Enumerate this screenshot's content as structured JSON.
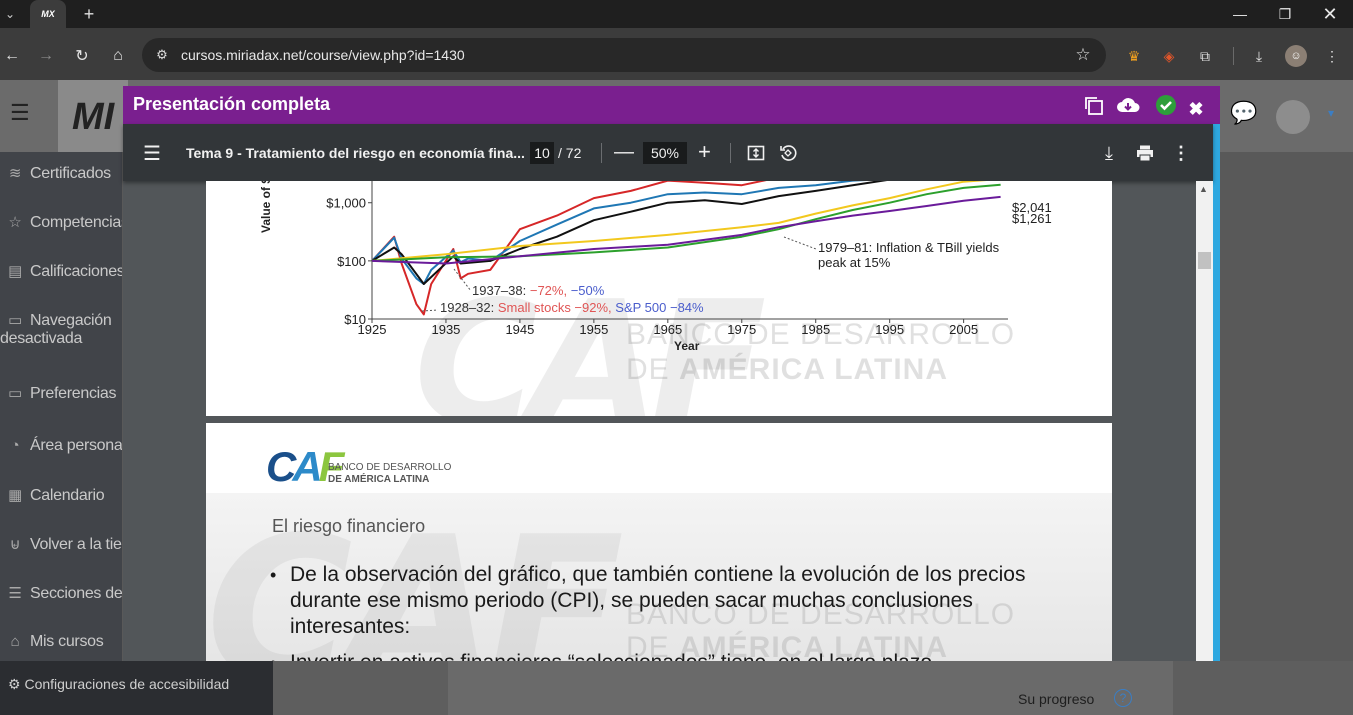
{
  "browser": {
    "tab_favicon": "MX",
    "url": "cursos.miriadax.net/course/view.php?id=1430"
  },
  "page": {
    "logo": "MI",
    "sidebar": [
      {
        "icon": "layers-icon",
        "glyph": "≋",
        "label": "Certificados"
      },
      {
        "icon": "star-icon",
        "glyph": "☆",
        "label": "Competencias"
      },
      {
        "icon": "book-icon",
        "glyph": "▤",
        "label": "Calificaciones"
      },
      {
        "icon": "folder-icon",
        "glyph": "▭",
        "label": "Navegación",
        "label2": "desactivada"
      },
      {
        "icon": "folder-icon",
        "glyph": "▭",
        "label": "Preferencias"
      },
      {
        "icon": "dashboard-icon",
        "glyph": "◔",
        "label": "Área personal"
      },
      {
        "icon": "calendar-icon",
        "glyph": "▦",
        "label": "Calendario"
      },
      {
        "icon": "cart-icon",
        "glyph": "⊌",
        "label": "Volver a la tienda"
      },
      {
        "icon": "list-icon",
        "glyph": "☰",
        "label": "Secciones del curso"
      },
      {
        "icon": "graduation-icon",
        "glyph": "⌂",
        "label": "Mis cursos"
      }
    ],
    "accessibility_label": "Configuraciones de accesibilidad",
    "progress_label": "Su progreso",
    "help_glyph": "?"
  },
  "modal": {
    "title": "Presentación completa"
  },
  "pdf": {
    "title": "Tema 9 - Tratamiento del riesgo en economía fina...",
    "page_current": "10",
    "page_total": "/ 72",
    "zoom": "50%"
  },
  "slide1": {
    "chart": {
      "ylabel": "Value of $",
      "xlabel": "Year",
      "y_ticks": [
        "$10",
        "$100",
        "$1,000"
      ],
      "x_ticks": [
        "1925",
        "1935",
        "1945",
        "1955",
        "1965",
        "1975",
        "1985",
        "1995",
        "2005"
      ],
      "end_labels": [
        "$2,041",
        "$1,261"
      ],
      "annotation_1979": "1979–81: Inflation & TBill yields",
      "annotation_1979_b": "peak at 15%",
      "annotation_1937_prefix": "1937–38:",
      "annotation_1937_red": "−72%,",
      "annotation_1937_blue": "−50%",
      "annotation_1928_prefix": "1928–32:",
      "annotation_1928_red": "Small stocks −92%,",
      "annotation_1928_blue": "S&P 500 −84%"
    },
    "watermark_line1": "BANCO DE DESARROLLO",
    "watermark_line2_a": "DE ",
    "watermark_line2_b": "AMÉRICA LATINA"
  },
  "slide2": {
    "logo_caf": "CAF",
    "logo_line1": "BANCO DE DESARROLLO",
    "logo_line2": "DE AMÉRICA LATINA",
    "heading": "El riesgo financiero",
    "bullets": [
      "De la observación del gráfico, que también contiene la evolución de los precios durante ese mismo periodo (CPI), se pueden sacar muchas conclusiones interesantes:",
      "Invertir en activos financieros “seleccionados” tiene, en el largo plazo"
    ]
  },
  "chart_data": {
    "type": "line",
    "title": "",
    "xlabel": "Year",
    "ylabel": "Value of $",
    "xlim": [
      1925,
      2011
    ],
    "ylim": [
      10,
      3000
    ],
    "y_scale": "log",
    "series": [
      {
        "color": "#d62728",
        "x": [
          1925,
          1928,
          1929,
          1931,
          1932,
          1933,
          1936,
          1937,
          1938,
          1941,
          1945,
          1950,
          1955,
          1960,
          1965,
          1970,
          1975,
          1979
        ],
        "y": [
          100,
          260,
          90,
          18,
          12,
          40,
          160,
          50,
          60,
          70,
          350,
          600,
          1200,
          1600,
          2400,
          2200,
          2000,
          3000
        ]
      },
      {
        "color": "#1f77b4",
        "x": [
          1925,
          1928,
          1929,
          1931,
          1932,
          1933,
          1936,
          1937,
          1938,
          1941,
          1945,
          1950,
          1955,
          1960,
          1965,
          1970,
          1975,
          1980,
          1985,
          1990,
          1995
        ],
        "y": [
          100,
          250,
          110,
          50,
          40,
          70,
          150,
          95,
          110,
          100,
          220,
          420,
          800,
          1000,
          1400,
          1500,
          1400,
          1800,
          2000,
          2400,
          3000
        ]
      },
      {
        "color": "#111111",
        "x": [
          1925,
          1928,
          1929,
          1932,
          1936,
          1937,
          1941,
          1945,
          1950,
          1955,
          1960,
          1965,
          1970,
          1975,
          1980,
          1985,
          1990,
          1995,
          2000
        ],
        "y": [
          100,
          170,
          130,
          40,
          120,
          90,
          100,
          160,
          260,
          500,
          700,
          1000,
          1100,
          950,
          1300,
          1600,
          2000,
          2500,
          3000
        ]
      },
      {
        "color": "#f2c81e",
        "x": [
          1925,
          1935,
          1945,
          1955,
          1965,
          1975,
          1980,
          1985,
          1990,
          1995,
          2000,
          2005,
          2010
        ],
        "y": [
          100,
          130,
          180,
          220,
          280,
          380,
          450,
          650,
          900,
          1200,
          1700,
          2300,
          3000
        ]
      },
      {
        "color": "#2ca02c",
        "x": [
          1925,
          1935,
          1945,
          1955,
          1965,
          1975,
          1980,
          1985,
          1990,
          1995,
          2000,
          2005,
          2010
        ],
        "y": [
          100,
          115,
          120,
          140,
          170,
          260,
          350,
          520,
          750,
          1000,
          1400,
          1800,
          2041
        ]
      },
      {
        "color": "#6a1b9a",
        "x": [
          1925,
          1935,
          1945,
          1955,
          1965,
          1975,
          1980,
          1985,
          1990,
          1995,
          2000,
          2005,
          2010
        ],
        "y": [
          100,
          90,
          120,
          160,
          190,
          280,
          380,
          480,
          600,
          720,
          880,
          1080,
          1261
        ]
      }
    ]
  }
}
